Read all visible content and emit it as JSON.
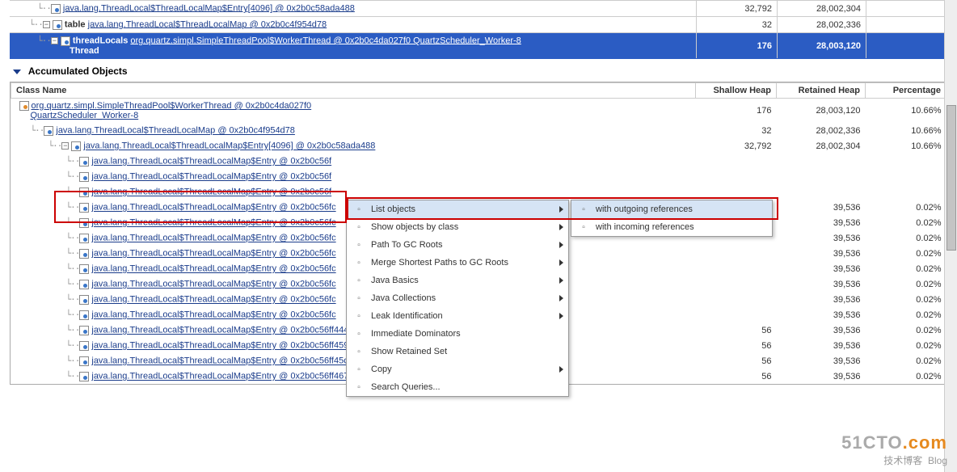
{
  "top_rows": [
    {
      "indent": 28,
      "icon": "obj",
      "link": "java.lang.ThreadLocal$ThreadLocalMap$Entry[4096] @ 0x2b0c58ada488",
      "c1": "32,792",
      "c2": "28,002,304",
      "c3": ""
    },
    {
      "indent": 18,
      "icon": "expander",
      "bold_pre": "table",
      "link": "java.lang.ThreadLocal$ThreadLocalMap @ 0x2b0c4f954d78",
      "c1": "32",
      "c2": "28,002,336",
      "c3": ""
    },
    {
      "selected": true,
      "indent": 28,
      "icon": "expander",
      "bold_pre": "threadLocals",
      "link": "org.quartz.simpl.SimpleThreadPool$WorkerThread @ 0x2b0c4da027f0 QuartzScheduler_Worker-8",
      "post": "Thread",
      "c1": "176",
      "c2": "28,003,120",
      "c3": ""
    }
  ],
  "section_title": "Accumulated Objects",
  "headers": {
    "c0": "Class Name",
    "c1": "Shallow Heap",
    "c2": "Retained Heap",
    "c3": "Percentage"
  },
  "acc_rows": [
    {
      "indent": 0,
      "orange": true,
      "link": "org.quartz.simpl.SimpleThreadPool$WorkerThread @ 0x2b0c4da027f0",
      "wrap": "QuartzScheduler_Worker-8",
      "c1": "176",
      "c2": "28,003,120",
      "c3": "10.66%"
    },
    {
      "indent": 14,
      "link": "java.lang.ThreadLocal$ThreadLocalMap @ 0x2b0c4f954d78",
      "c1": "32",
      "c2": "28,002,336",
      "c3": "10.66%"
    },
    {
      "indent": 36,
      "expander": true,
      "link": "java.lang.ThreadLocal$ThreadLocalMap$Entry[4096] @ 0x2b0c58ada488",
      "c1": "32,792",
      "c2": "28,002,304",
      "c3": "10.66%"
    },
    {
      "indent": 58,
      "link": "java.lang.ThreadLocal$ThreadLocalMap$Entry @ 0x2b0c56f",
      "c1": "",
      "c2": "",
      "c3": ""
    },
    {
      "indent": 58,
      "link": "java.lang.ThreadLocal$ThreadLocalMap$Entry @ 0x2b0c56f",
      "c1": "",
      "c2": "",
      "c3": ""
    },
    {
      "indent": 58,
      "link": "java.lang.ThreadLocal$ThreadLocalMap$Entry @ 0x2b0c56f",
      "c1": "",
      "c2": "",
      "c3": ""
    },
    {
      "indent": 58,
      "link": "java.lang.ThreadLocal$ThreadLocalMap$Entry @ 0x2b0c56fc",
      "c1": "",
      "c2": "39,536",
      "c3": "0.02%"
    },
    {
      "indent": 58,
      "link": "java.lang.ThreadLocal$ThreadLocalMap$Entry @ 0x2b0c56fc",
      "c1": "",
      "c2": "39,536",
      "c3": "0.02%"
    },
    {
      "indent": 58,
      "link": "java.lang.ThreadLocal$ThreadLocalMap$Entry @ 0x2b0c56fc",
      "c1": "",
      "c2": "39,536",
      "c3": "0.02%"
    },
    {
      "indent": 58,
      "link": "java.lang.ThreadLocal$ThreadLocalMap$Entry @ 0x2b0c56fc",
      "c1": "",
      "c2": "39,536",
      "c3": "0.02%"
    },
    {
      "indent": 58,
      "link": "java.lang.ThreadLocal$ThreadLocalMap$Entry @ 0x2b0c56fc",
      "c1": "",
      "c2": "39,536",
      "c3": "0.02%"
    },
    {
      "indent": 58,
      "link": "java.lang.ThreadLocal$ThreadLocalMap$Entry @ 0x2b0c56fc",
      "c1": "",
      "c2": "39,536",
      "c3": "0.02%"
    },
    {
      "indent": 58,
      "link": "java.lang.ThreadLocal$ThreadLocalMap$Entry @ 0x2b0c56fc",
      "c1": "",
      "c2": "39,536",
      "c3": "0.02%"
    },
    {
      "indent": 58,
      "link": "java.lang.ThreadLocal$ThreadLocalMap$Entry @ 0x2b0c56fc",
      "c1": "",
      "c2": "39,536",
      "c3": "0.02%"
    },
    {
      "indent": 58,
      "link": "java.lang.ThreadLocal$ThreadLocalMap$Entry @ 0x2b0c56ff4440",
      "c1": "56",
      "c2": "39,536",
      "c3": "0.02%"
    },
    {
      "indent": 58,
      "link": "java.lang.ThreadLocal$ThreadLocalMap$Entry @ 0x2b0c56ff4590",
      "c1": "56",
      "c2": "39,536",
      "c3": "0.02%"
    },
    {
      "indent": 58,
      "link": "java.lang.ThreadLocal$ThreadLocalMap$Entry @ 0x2b0c56ff45c8",
      "c1": "56",
      "c2": "39,536",
      "c3": "0.02%"
    },
    {
      "indent": 58,
      "link": "java.lang.ThreadLocal$ThreadLocalMap$Entry @ 0x2b0c56ff4670",
      "c1": "56",
      "c2": "39,536",
      "c3": "0.02%"
    }
  ],
  "context_menu": {
    "items": [
      {
        "label": "List objects",
        "arrow": true,
        "sel": true
      },
      {
        "label": "Show objects by class",
        "arrow": true
      },
      {
        "label": "Path To GC Roots",
        "arrow": true
      },
      {
        "label": "Merge Shortest Paths to GC Roots",
        "arrow": true
      },
      {
        "label": "Java Basics",
        "arrow": true
      },
      {
        "label": "Java Collections",
        "arrow": true
      },
      {
        "label": "Leak Identification",
        "arrow": true
      },
      {
        "label": "Immediate Dominators"
      },
      {
        "label": "Show Retained Set"
      },
      {
        "label": "Copy",
        "arrow": true
      },
      {
        "label": "Search Queries..."
      }
    ]
  },
  "submenu": {
    "items": [
      {
        "label": "with outgoing references",
        "sel": true
      },
      {
        "label": "with incoming references"
      }
    ]
  },
  "watermark": {
    "line1a": "51CTO",
    "line1b": ".com",
    "line2": "技术博客",
    "line2b": "Blog"
  }
}
